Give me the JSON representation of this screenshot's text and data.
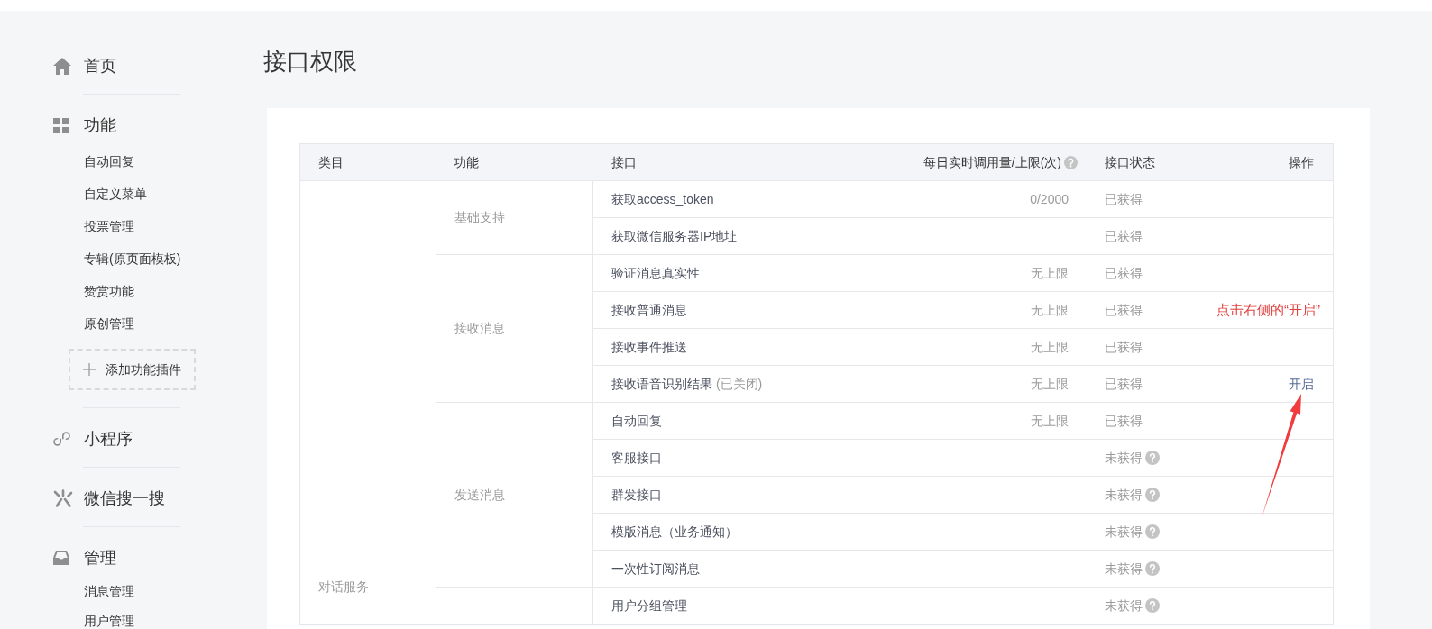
{
  "sidebar": {
    "sections": [
      {
        "label": "首页",
        "kind": "home"
      },
      {
        "label": "功能",
        "kind": "grid",
        "items": [
          "自动回复",
          "自定义菜单",
          "投票管理",
          "专辑(原页面模板)",
          "赞赏功能",
          "原创管理"
        ],
        "add_button": "添加功能插件"
      },
      {
        "label": "小程序",
        "kind": "loops"
      },
      {
        "label": "微信搜一搜",
        "kind": "burst"
      },
      {
        "label": "管理",
        "kind": "inbox",
        "items": [
          "消息管理",
          "用户管理"
        ]
      }
    ]
  },
  "page_title": "接口权限",
  "table": {
    "columns": [
      {
        "label": "类目"
      },
      {
        "label": "功能"
      },
      {
        "label": "接口"
      },
      {
        "label": "每日实时调用量/上限(次)",
        "help": true
      },
      {
        "label": "接口状态"
      },
      {
        "label": "操作"
      }
    ],
    "categories": [
      {
        "name": "对话服务",
        "groups": [
          {
            "function": "基础支持",
            "interfaces": [
              {
                "name": "获取access_token",
                "quota": "0/2000",
                "status": "已获得"
              },
              {
                "name": "获取微信服务器IP地址",
                "status": "已获得"
              }
            ]
          },
          {
            "function": "接收消息",
            "interfaces": [
              {
                "name": "验证消息真实性",
                "quota": "无上限",
                "status": "已获得"
              },
              {
                "name": "接收普通消息",
                "quota": "无上限",
                "status": "已获得"
              },
              {
                "name": "接收事件推送",
                "quota": "无上限",
                "status": "已获得"
              },
              {
                "name": "接收语音识别结果",
                "note": "(已关闭)",
                "quota": "无上限",
                "status": "已获得",
                "action": "开启"
              }
            ]
          },
          {
            "function": "发送消息",
            "interfaces": [
              {
                "name": "自动回复",
                "quota": "无上限",
                "status": "已获得"
              },
              {
                "name": "客服接口",
                "status": "未获得",
                "help": true
              },
              {
                "name": "群发接口",
                "status": "未获得",
                "help": true
              },
              {
                "name": "模版消息（业务通知）",
                "status": "未获得",
                "help": true
              },
              {
                "name": "一次性订阅消息",
                "status": "未获得",
                "help": true
              }
            ]
          },
          {
            "interfaces": [
              {
                "name": "用户分组管理",
                "status": "未获得",
                "help": true
              }
            ]
          }
        ]
      }
    ]
  },
  "annotation": {
    "text": "点击右侧的“开启”"
  }
}
